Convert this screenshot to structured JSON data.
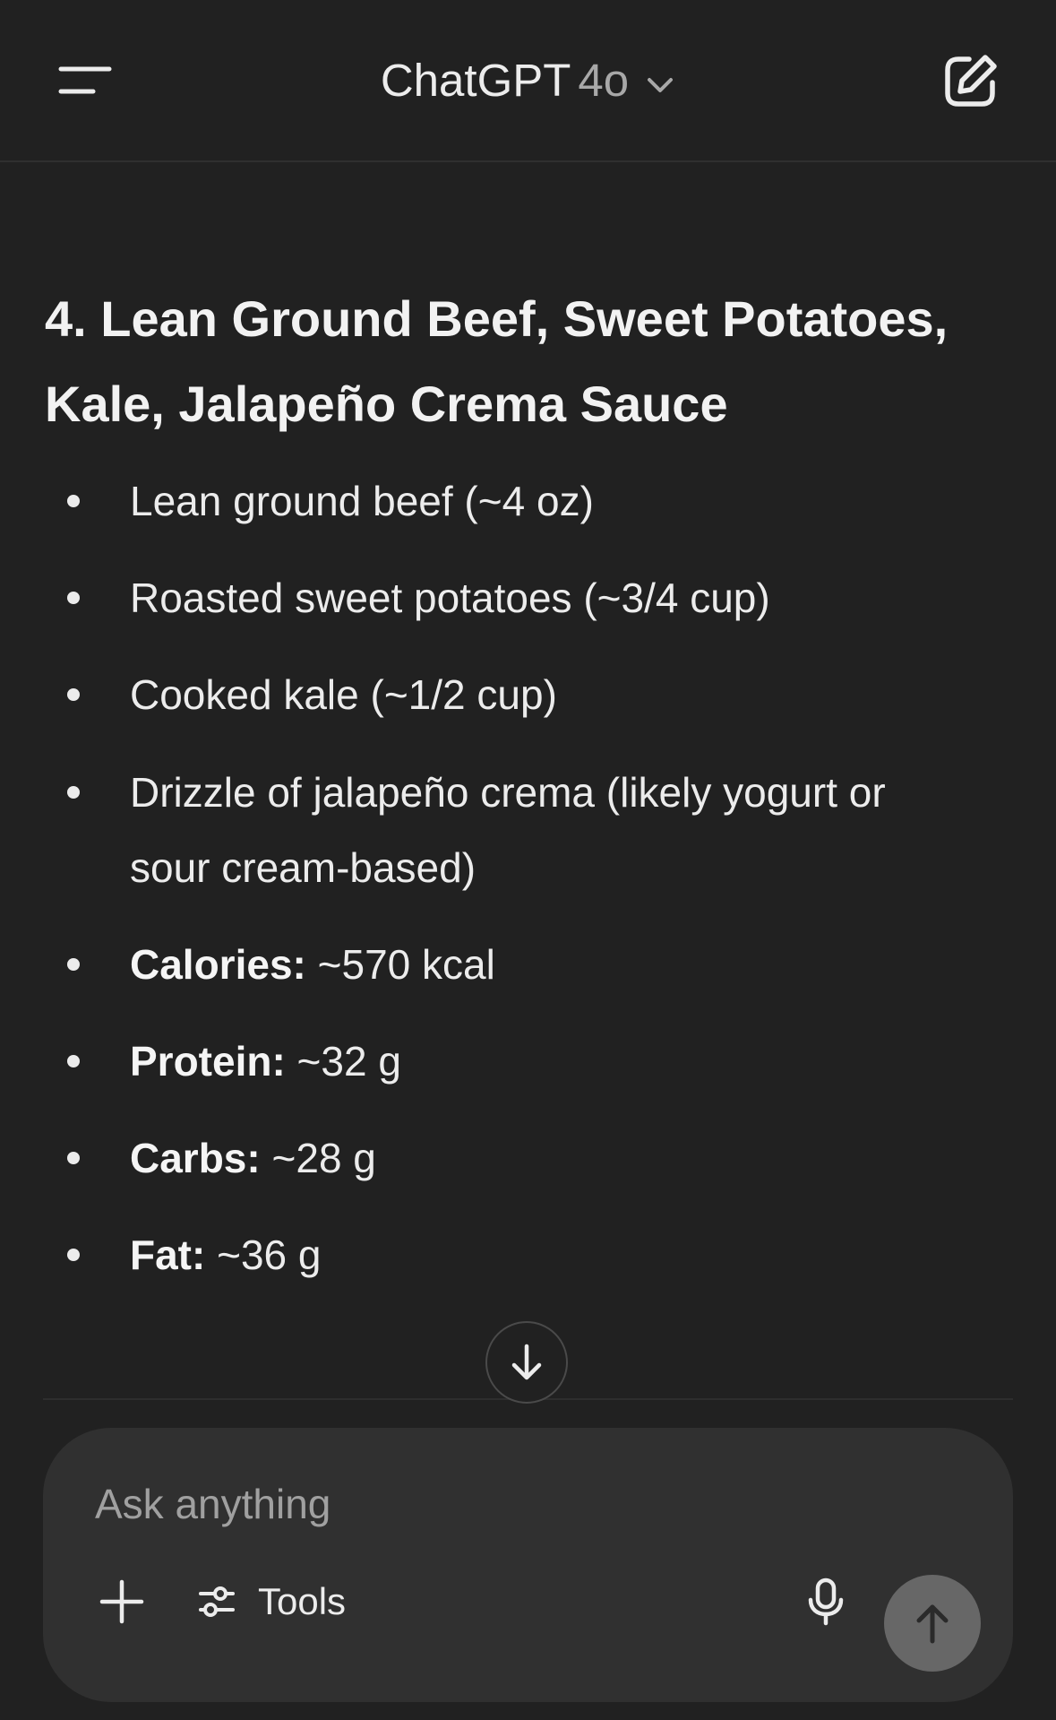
{
  "header": {
    "menu_icon": "menu-icon",
    "app_name": "ChatGPT",
    "model": "4o",
    "model_chevron_icon": "chevron-down-icon",
    "new_chat_icon": "edit-icon"
  },
  "message": {
    "heading_line1": "4. Lean Ground Beef, Sweet Potatoes,",
    "heading_line2": "Kale, Jalapeño Crema Sauce",
    "items": [
      {
        "text": "Lean ground beef (~4 oz)"
      },
      {
        "text": "Roasted sweet potatoes (~3/4 cup)"
      },
      {
        "text": "Cooked kale (~1/2 cup)"
      },
      {
        "text_line1": "Drizzle of jalapeño crema (likely yogurt or",
        "text_line2": "sour cream-based)"
      },
      {
        "label": "Calories:",
        "value": " ~570 kcal"
      },
      {
        "label": "Protein:",
        "value": " ~32 g"
      },
      {
        "label": "Carbs:",
        "value": " ~28 g"
      },
      {
        "label": "Fat:",
        "value": " ~36 g"
      }
    ]
  },
  "scroll_down_icon": "arrow-down-icon",
  "composer": {
    "placeholder": "Ask anything",
    "plus_icon": "plus-icon",
    "tools_icon": "sliders-icon",
    "tools_label": "Tools",
    "mic_icon": "microphone-icon",
    "send_icon": "arrow-up-icon"
  }
}
